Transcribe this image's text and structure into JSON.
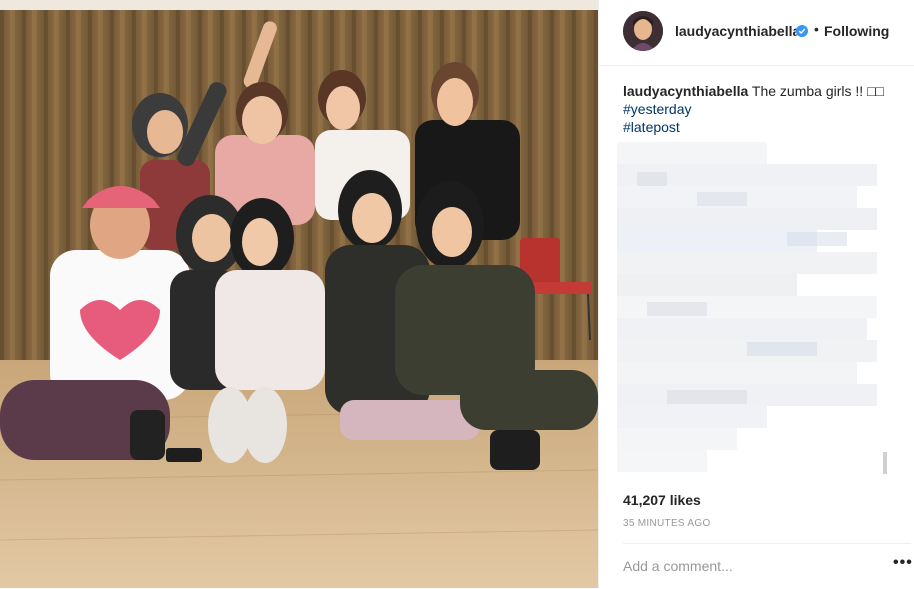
{
  "post": {
    "username": "laudyacynthiabella",
    "verified_icon": "verified-badge-icon",
    "separator": "•",
    "follow_status": "Following",
    "caption": {
      "username": "laudyacynthiabella",
      "text": "The zumba girls !! □□",
      "hashtags": [
        "#yesterday",
        "#latepost"
      ]
    },
    "likes": "41,207 likes",
    "timestamp": "35 MINUTES AGO",
    "comment_placeholder": "Add a comment...",
    "more_icon": "more-options-icon"
  },
  "colors": {
    "accent_blue": "#3897f0",
    "hashtag": "#003569",
    "text": "#262626",
    "muted": "#999999"
  }
}
